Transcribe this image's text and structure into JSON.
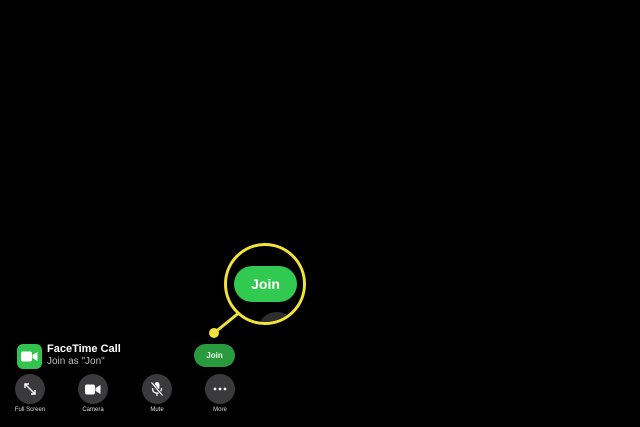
{
  "callout": {
    "join_label": "Join"
  },
  "notification": {
    "title": "FaceTime Call",
    "subtitle": "Join as \"Jon\"",
    "join_label": "Join",
    "icon": "facetime-video-icon"
  },
  "controls": [
    {
      "label": "Full Screen",
      "icon": "expand-arrows-icon"
    },
    {
      "label": "Camera",
      "icon": "camera-icon"
    },
    {
      "label": "Mute",
      "icon": "mic-slash-icon"
    },
    {
      "label": "More",
      "icon": "ellipsis-icon"
    }
  ],
  "colors": {
    "background": "#000000",
    "accent_green": "#31c94f",
    "highlight_yellow": "#f2e33b",
    "button_gray": "#3a3a3c"
  }
}
